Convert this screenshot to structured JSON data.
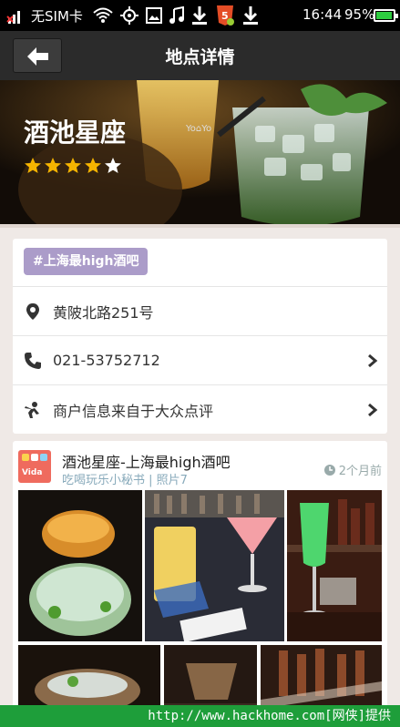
{
  "status_bar": {
    "carrier": "无SIM卡",
    "time": "16:44",
    "battery_percent": "95%",
    "battery_level": 0.95
  },
  "title_bar": {
    "title": "地点详情"
  },
  "hero": {
    "place_name": "酒池星座",
    "rating": 4,
    "rating_max": 5,
    "watermark": "Yo⌂Yo"
  },
  "info": {
    "tag": "#上海最high酒吧",
    "address": "黄陂北路251号",
    "phone": "021-53752712",
    "source": "商户信息来自于大众点评"
  },
  "feed": {
    "title": "酒池星座-上海最high酒吧",
    "author": "吃喝玩乐小秘书",
    "photo_count": "照片7",
    "time_ago": "2个月前",
    "logo_text": "Vida"
  },
  "footer": {
    "text": "http://www.hackhome.com[网侠]提供"
  },
  "colors": {
    "title_bar": "#2b2b2b",
    "tag": "#ab9cc9",
    "footer": "#1e9e3a",
    "star": "#f5b400"
  }
}
